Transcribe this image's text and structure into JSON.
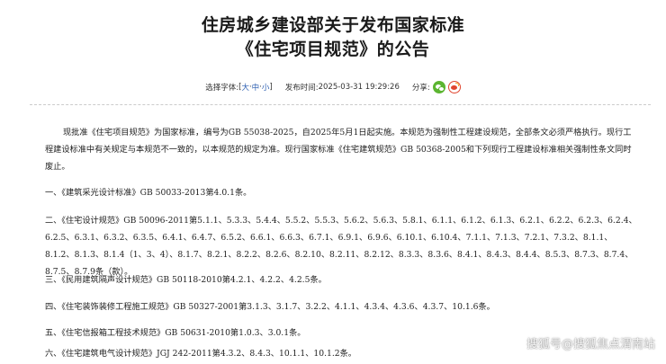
{
  "title": {
    "line1": "住房城乡建设部关于发布国家标准",
    "line2": "《住宅项目规范》的公告"
  },
  "meta": {
    "font_label": "选择字体:",
    "bracket_open": "[",
    "font_large": "大",
    "sep1": "·",
    "font_medium": "中",
    "sep2": "·",
    "font_small": "小",
    "bracket_close": "]",
    "publish_label": "发布时间:",
    "publish_time": "2025-03-31 19:29:26",
    "share_label": "分享:",
    "share_icons": [
      "wechat-icon",
      "weibo-icon"
    ]
  },
  "body": {
    "intro": "现批准《住宅项目规范》为国家标准，编号为GB 55038-2025，自2025年5月1日起实施。本规范为强制性工程建设规范，全部条文必须严格执行。现行工程建设标准中有关规定与本规范不一致的，以本规范的规定为准。现行国家标准《住宅建筑规范》GB 50368-2005和下列现行工程建设标准相关强制性条文同时废止。",
    "items": [
      "一、《建筑采光设计标准》GB 50033-2013第4.0.1条。",
      "二、《住宅设计规范》GB 50096-2011第5.1.1、5.3.3、5.4.4、5.5.2、5.5.3、5.6.2、5.6.3、5.8.1、6.1.1、6.1.2、6.1.3、6.2.1、6.2.2、6.2.3、6.2.4、6.2.5、6.3.1、6.3.2、6.3.5、6.4.1、6.4.7、6.5.2、6.6.1、6.6.3、6.7.1、6.9.1、6.9.6、6.10.1、6.10.4、7.1.1、7.1.3、7.2.1、7.3.2、8.1.1、8.1.2、8.1.3、8.1.4（1、3、4）、8.1.7、8.2.1、8.2.2、8.2.6、8.2.10、8.2.11、8.2.12、8.3.3、8.3.6、8.4.1、8.4.3、8.4.4、8.5.3、8.7.3、8.7.4、8.7.5、8.7.9条（款）。",
      "三、《民用建筑隔声设计规范》GB 50118-2010第4.2.1、4.2.2、4.2.5条。",
      "四、《住宅装饰装修工程施工规范》GB 50327-2001第3.1.3、3.1.7、3.2.2、4.1.1、4.3.4、4.3.6、4.3.7、10.1.6条。",
      "五、《住宅信报箱工程技术规范》GB 50631-2010第1.0.3、3.0.1条。",
      "六、《住宅建筑电气设计规范》JGJ 242-2011第4.3.2、8.4.3、10.1.1、10.1.2条。"
    ]
  },
  "watermark": "搜狐号@搜狐焦点渭南站"
}
